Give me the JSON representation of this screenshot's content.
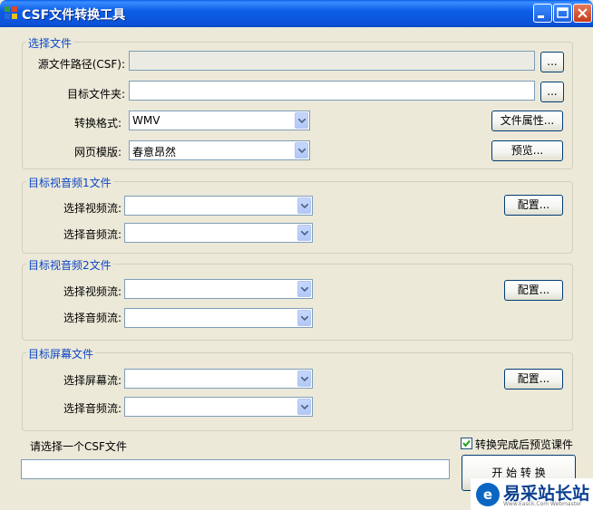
{
  "window": {
    "title": "CSF文件转换工具"
  },
  "select_file": {
    "legend": "选择文件",
    "source_path_label": "源文件路径(CSF):",
    "source_path_value": "",
    "source_browse": "...",
    "target_folder_label": "目标文件夹:",
    "target_folder_value": "",
    "target_browse": "...",
    "format_label": "转换格式:",
    "format_value": "WMV",
    "file_props_button": "文件属性...",
    "template_label": "网页模版:",
    "template_value": "春意昂然",
    "preview_button": "预览..."
  },
  "av1": {
    "legend": "目标视音频1文件",
    "video_label": "选择视频流:",
    "audio_label": "选择音频流:",
    "config_button": "配置..."
  },
  "av2": {
    "legend": "目标视音频2文件",
    "video_label": "选择视频流:",
    "audio_label": "选择音频流:",
    "config_button": "配置..."
  },
  "screen": {
    "legend": "目标屏幕文件",
    "screen_label": "选择屏幕流:",
    "audio_label": "选择音频流:",
    "config_button": "配置..."
  },
  "footer": {
    "status_text": "请选择一个CSF文件",
    "preview_after_label": "转换完成后预览课件",
    "preview_after_checked": true,
    "progress_value": 0,
    "start_button": "开 始 转 换"
  },
  "watermark": {
    "logo_text": "e",
    "text": "易采站长站",
    "sub": "Www.Easck.Com Webmaster"
  },
  "colors": {
    "title_bar": "#0b52d8",
    "window_bg": "#ece9d8",
    "legend": "#0b46c8",
    "field_border": "#7f9db9",
    "button_border": "#003c74"
  }
}
